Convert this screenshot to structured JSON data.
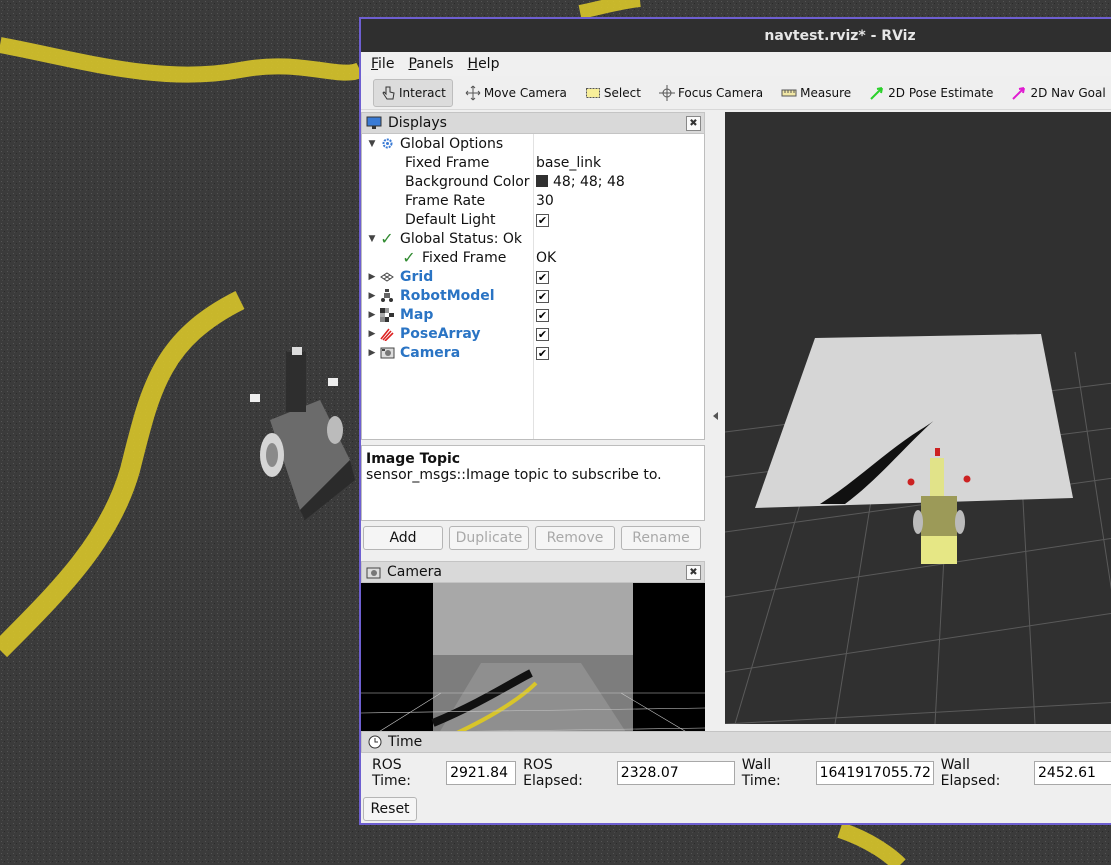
{
  "window": {
    "title": "navtest.rviz* - RViz"
  },
  "menu": [
    "File",
    "Panels",
    "Help"
  ],
  "toolbar": [
    {
      "label": "Interact",
      "icon": "hand-pointer-icon",
      "active": true
    },
    {
      "label": "Move Camera",
      "icon": "move-arrows-icon",
      "active": false
    },
    {
      "label": "Select",
      "icon": "select-rectangle-icon",
      "active": false
    },
    {
      "label": "Focus Camera",
      "icon": "focus-crosshair-icon",
      "active": false
    },
    {
      "label": "Measure",
      "icon": "ruler-icon",
      "active": false
    },
    {
      "label": "2D Pose Estimate",
      "icon": "green-arrow-icon",
      "active": false
    },
    {
      "label": "2D Nav Goal",
      "icon": "magenta-arrow-icon",
      "active": false
    }
  ],
  "displays": {
    "title": "Displays",
    "global_options": {
      "label": "Global Options",
      "fixed_frame": {
        "label": "Fixed Frame",
        "value": "base_link"
      },
      "background_color": {
        "label": "Background Color",
        "value": "48; 48; 48",
        "swatch": "#303030"
      },
      "frame_rate": {
        "label": "Frame Rate",
        "value": "30"
      },
      "default_light": {
        "label": "Default Light",
        "checked": true
      }
    },
    "global_status": {
      "label": "Global Status: Ok",
      "fixed_frame": {
        "label": "Fixed Frame",
        "value": "OK"
      }
    },
    "items": [
      {
        "label": "Grid",
        "icon": "grid-icon",
        "checked": true
      },
      {
        "label": "RobotModel",
        "icon": "robot-icon",
        "checked": true
      },
      {
        "label": "Map",
        "icon": "map-icon",
        "checked": true
      },
      {
        "label": "PoseArray",
        "icon": "pose-array-icon",
        "checked": true
      },
      {
        "label": "Camera",
        "icon": "camera-icon",
        "checked": true
      }
    ],
    "description": {
      "title": "Image Topic",
      "text": "sensor_msgs::Image topic to subscribe to."
    },
    "buttons": {
      "add": "Add",
      "duplicate": "Duplicate",
      "remove": "Remove",
      "rename": "Rename"
    }
  },
  "camera_panel": {
    "title": "Camera"
  },
  "time_panel": {
    "title": "Time",
    "ros_time": {
      "label": "ROS Time:",
      "value": "2921.84"
    },
    "ros_elapsed": {
      "label": "ROS Elapsed:",
      "value": "2328.07"
    },
    "wall_time": {
      "label": "Wall Time:",
      "value": "1641917055.72"
    },
    "wall_elapsed": {
      "label": "Wall Elapsed:",
      "value": "2452.61"
    },
    "reset": "Reset"
  },
  "colors": {
    "accent": "#6e5fd1",
    "link_blue": "#2a74c4",
    "lane_yellow": "#d8c52a"
  }
}
